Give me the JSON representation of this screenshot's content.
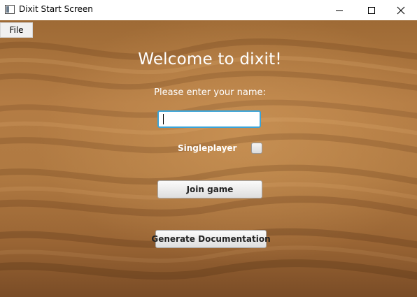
{
  "window": {
    "title": "Dixit Start Screen",
    "controls": {
      "minimize_icon": "minimize-icon",
      "maximize_icon": "maximize-icon",
      "close_icon": "close-icon"
    }
  },
  "menu": {
    "items": [
      {
        "label": "File"
      }
    ]
  },
  "main": {
    "heading": "Welcome to dixit!",
    "prompt": "Please enter your name:",
    "name_input": {
      "value": "",
      "placeholder": ""
    },
    "singleplayer": {
      "label": "Singleplayer",
      "checked": false
    },
    "join_button": "Join game",
    "docs_button": "Generate Documentation"
  },
  "colors": {
    "background_sand": "#b07a42",
    "input_focus_border": "#3ba4d8",
    "text_on_background": "#ffffff"
  }
}
